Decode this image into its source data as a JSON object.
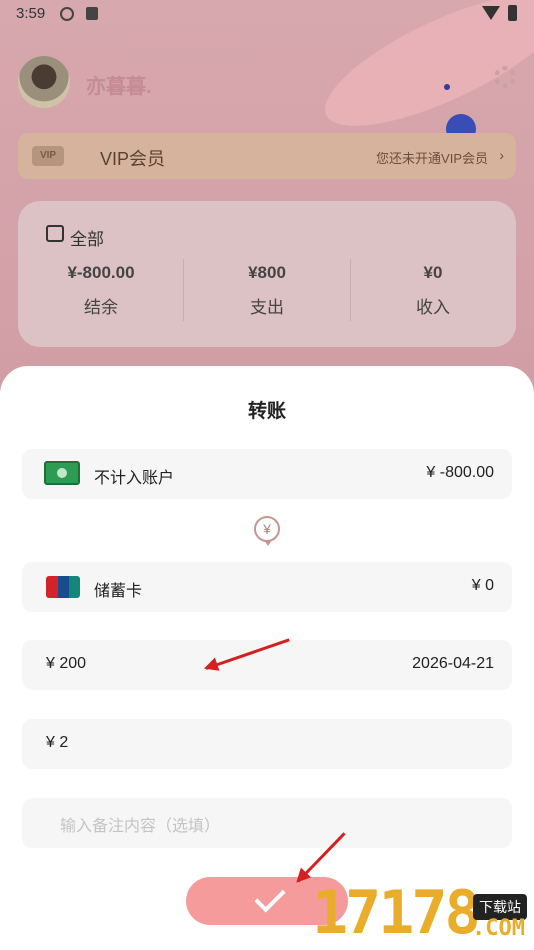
{
  "status_bar": {
    "time": "3:59"
  },
  "profile": {
    "username": "亦暮暮."
  },
  "vip": {
    "badge": "VIP",
    "label": "VIP会员",
    "note": "您还未开通VIP会员",
    "chevron": "›"
  },
  "summary": {
    "period": "全部",
    "columns": [
      {
        "value": "¥-800.00",
        "label": "结余"
      },
      {
        "value": "¥800",
        "label": "支出"
      },
      {
        "value": "¥0",
        "label": "收入"
      }
    ]
  },
  "sheet": {
    "title": "转账",
    "from_account": {
      "name": "不计入账户",
      "balance": "¥ -800.00",
      "icon": "cash-icon"
    },
    "transfer_icon": "¥",
    "to_account": {
      "name": "储蓄卡",
      "balance": "¥ 0",
      "icon": "unionpay-card-icon"
    },
    "amount": {
      "value": "¥ 200",
      "date": "2026-04-21"
    },
    "fee": {
      "value": "¥ 2"
    },
    "note": {
      "placeholder": "输入备注内容（选填）"
    },
    "confirm_icon": "check-icon"
  },
  "watermark": {
    "digits": "17178",
    "badge": "下载站",
    "domain": ".COM"
  },
  "colors": {
    "confirm_button": "#f69b9c",
    "annotation_arrow": "#d81f1f"
  }
}
